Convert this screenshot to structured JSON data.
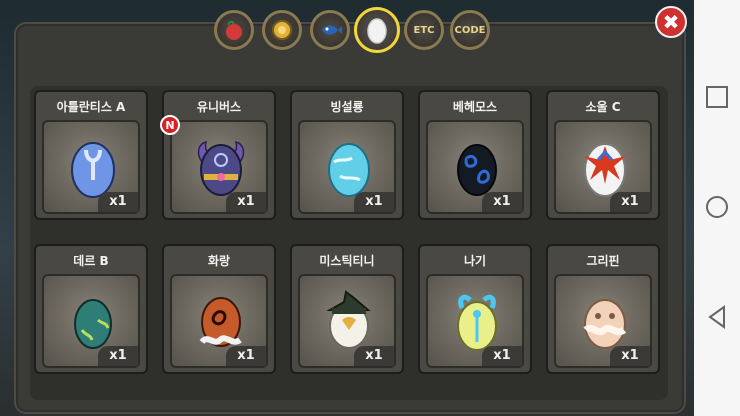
{
  "tabs": [
    {
      "name": "fruit",
      "icon": "apple-icon",
      "label": ""
    },
    {
      "name": "coin",
      "icon": "coin-icon",
      "label": ""
    },
    {
      "name": "fish",
      "icon": "fish-icon",
      "label": ""
    },
    {
      "name": "egg",
      "icon": "egg-icon",
      "label": "",
      "active": true
    },
    {
      "name": "etc",
      "icon": "",
      "label": "ETC"
    },
    {
      "name": "code",
      "icon": "",
      "label": "CODE"
    }
  ],
  "close_label": "✖",
  "new_badge": "N",
  "cards": [
    {
      "title": "아틀란티스 A",
      "count": "x1",
      "color": "#6a8fe0"
    },
    {
      "title": "유니버스",
      "count": "x1",
      "color": "#4b4a86"
    },
    {
      "title": "빙설룡",
      "count": "x1",
      "color": "#5bc8e8"
    },
    {
      "title": "베헤모스",
      "count": "x1",
      "color": "#1a2230"
    },
    {
      "title": "소울 C",
      "count": "x1",
      "color": "#f0f0f0"
    },
    {
      "title": "데르 B",
      "count": "x1",
      "color": "#2f7d77"
    },
    {
      "title": "화랑",
      "count": "x1",
      "color": "#c45a2a"
    },
    {
      "title": "미스틱티니",
      "count": "x1",
      "color": "#f2f0e6"
    },
    {
      "title": "나기",
      "count": "x1",
      "color": "#e9f08a"
    },
    {
      "title": "그리핀",
      "count": "x1",
      "color": "#f2d2b8"
    }
  ]
}
